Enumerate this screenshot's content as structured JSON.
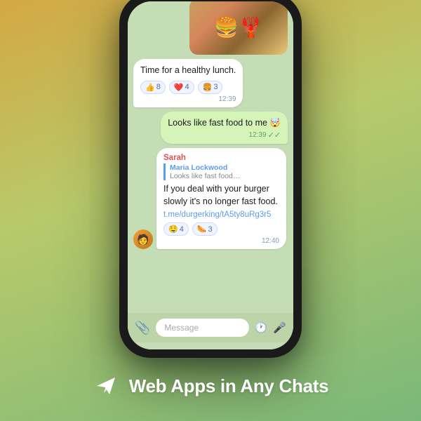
{
  "background": {
    "gradient_start": "#d4a843",
    "gradient_end": "#7ab87a"
  },
  "bottom_section": {
    "icon": "▶",
    "label": "Web Apps in Any Chats"
  },
  "chat": {
    "food_emoji": "🍔🦞",
    "message1": {
      "text": "Time for a healthy lunch.",
      "reactions": [
        {
          "emoji": "👍",
          "count": "8"
        },
        {
          "emoji": "❤️",
          "count": "4"
        },
        {
          "emoji": "🍔",
          "count": "3"
        }
      ],
      "time": "12:39"
    },
    "message2": {
      "text": "Looks like fast food to me 🤯",
      "time": "12:39",
      "read": true
    },
    "message3": {
      "sender": "Sarah",
      "quote_author": "Maria Lockwood",
      "quote_text": "Looks like fast food…",
      "body": "If you deal with your burger slowly it's no longer fast food.",
      "link": "t.me/durgerking/tA5ty8uRg3r5",
      "reactions": [
        {
          "emoji": "🤤",
          "count": "4"
        },
        {
          "emoji": "🌭",
          "count": "3"
        }
      ],
      "time": "12:40",
      "avatar_emoji": "🧑"
    }
  },
  "input_bar": {
    "placeholder": "Message",
    "attach_icon": "📎",
    "clock_icon": "🕐",
    "mic_icon": "🎤"
  }
}
